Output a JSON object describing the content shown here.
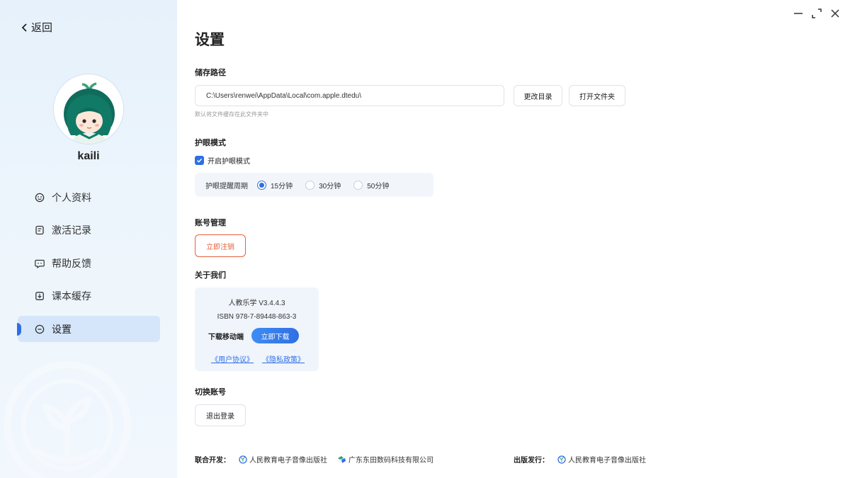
{
  "sidebar": {
    "back_label": "返回",
    "username": "kaili",
    "items": [
      {
        "label": "个人资料",
        "icon": "smile-icon",
        "active": false
      },
      {
        "label": "激活记录",
        "icon": "record-icon",
        "active": false
      },
      {
        "label": "帮助反馈",
        "icon": "feedback-icon",
        "active": false
      },
      {
        "label": "课本缓存",
        "icon": "download-icon",
        "active": false
      },
      {
        "label": "设置",
        "icon": "settings-icon",
        "active": true
      }
    ]
  },
  "main": {
    "title": "设置",
    "storage": {
      "label": "储存路径",
      "path": "C:\\Users\\renwei\\AppData\\Local\\com.apple.dtedu\\",
      "change_button": "更改目录",
      "open_button": "打开文件夹",
      "hint": "默认将文件缓存在此文件夹中"
    },
    "eye_care": {
      "label": "护眼模式",
      "checkbox_label": "开启护眼模式",
      "checked": true,
      "period_label": "护眼提醒周期",
      "options": [
        "15分钟",
        "30分钟",
        "50分钟"
      ],
      "selected": "15分钟"
    },
    "account": {
      "label": "账号管理",
      "cancel_button": "立即注销"
    },
    "about": {
      "label": "关于我们",
      "version": "人教乐学 V3.4.4.3",
      "isbn": "ISBN 978-7-89448-863-3",
      "download_label": "下载移动端",
      "download_button": "立即下载",
      "user_agreement": "《用户协议》",
      "privacy_policy": "《隐私政策》"
    },
    "switch_account": {
      "label": "切换账号",
      "logout_button": "退出登录"
    },
    "footer": {
      "co_dev_label": "联合开发：",
      "co_dev_org1": "人民教育电子音像出版社",
      "co_dev_org2": "广东东田数码科技有限公司",
      "publisher_label": "出版发行：",
      "publisher_org": "人民教育电子音像出版社"
    }
  },
  "colors": {
    "accent": "#2f6fe4",
    "danger": "#e8603c",
    "sidebar_bg": "#e6f1fb"
  }
}
